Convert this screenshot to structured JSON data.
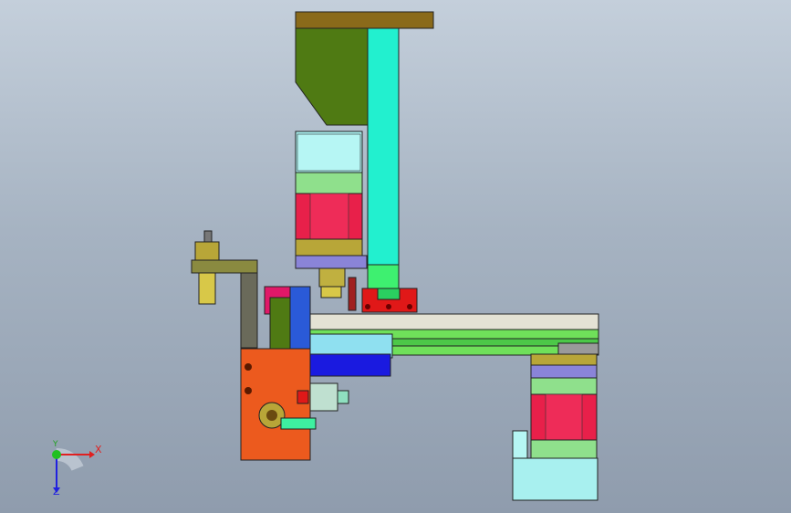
{
  "viewport": {
    "background_top": "#c4cfdb",
    "background_bottom": "#8f9cad"
  },
  "triad": {
    "x_label": "X",
    "y_label": "Y",
    "z_label": "Z",
    "x_color": "#e02020",
    "y_color": "#20c020",
    "z_color": "#2020e0"
  },
  "colors": {
    "olive_bracket": "#4f7a13",
    "top_bar": "#8a6a1a",
    "cyan_column": "#22f0cf",
    "motor_light_cyan": "#a8f0ef",
    "motor_red": "#e8204a",
    "motor_green": "#8fe08c",
    "motor_olive": "#b8a638",
    "motor_purple": "#8a84d8",
    "plate_cream": "#e4e2d4",
    "rail_green": "#6fe05a",
    "blue_block": "#1a1ae0",
    "orange_housing": "#ec5a1e",
    "red_clamp": "#e01818"
  }
}
